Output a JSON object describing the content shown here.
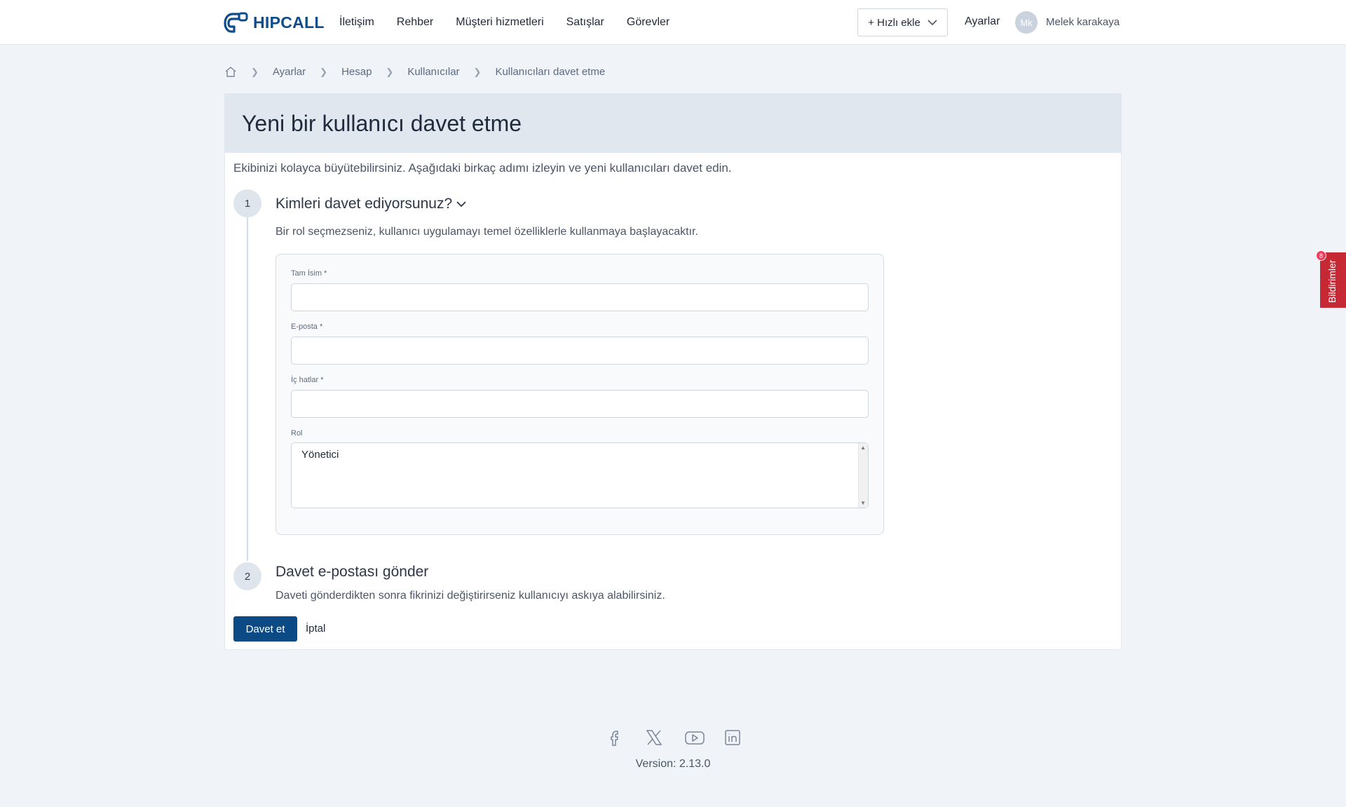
{
  "brand": {
    "name": "HIPCALL",
    "accent": "#0c4a86"
  },
  "nav": {
    "items": [
      "İletişim",
      "Rehber",
      "Müşteri hizmetleri",
      "Satışlar",
      "Görevler"
    ]
  },
  "header": {
    "quick_add": "+ Hızlı ekle",
    "settings": "Ayarlar",
    "avatar_initials": "Mk",
    "user_name": "Melek karakaya"
  },
  "breadcrumb": {
    "home_icon": "home-icon",
    "items": [
      "Ayarlar",
      "Hesap",
      "Kullanıcılar",
      "Kullanıcıları davet etme"
    ]
  },
  "page": {
    "title": "Yeni bir kullanıcı davet etme",
    "intro": "Ekibinizi kolayca büyütebilirsiniz. Aşağıdaki birkaç adımı izleyin ve yeni kullanıcıları davet edin."
  },
  "step1": {
    "number": "1",
    "title": "Kimleri davet ediyorsunuz?",
    "desc": "Bir rol seçmezseniz, kullanıcı uygulamayı temel özelliklerle kullanmaya başlayacaktır."
  },
  "form": {
    "full_name_label": "Tam İsim *",
    "full_name_value": "",
    "email_label": "E-posta *",
    "email_value": "",
    "extension_label": "İç hatlar *",
    "extension_value": "",
    "role_label": "Rol",
    "role_options": [
      "Yönetici"
    ]
  },
  "step2": {
    "number": "2",
    "title": "Davet e-postası gönder",
    "desc": "Daveti gönderdikten sonra fikrinizi değiştirirseniz kullanıcıyı askıya alabilirsiniz."
  },
  "actions": {
    "invite": "Davet et",
    "cancel": "İptal"
  },
  "feedback": {
    "label": "Bildirimler",
    "badge": "8",
    "color": "#c62834"
  },
  "footer": {
    "socials": [
      "facebook-icon",
      "x-icon",
      "youtube-icon",
      "linkedin-icon"
    ],
    "version": "Version: 2.13.0"
  }
}
